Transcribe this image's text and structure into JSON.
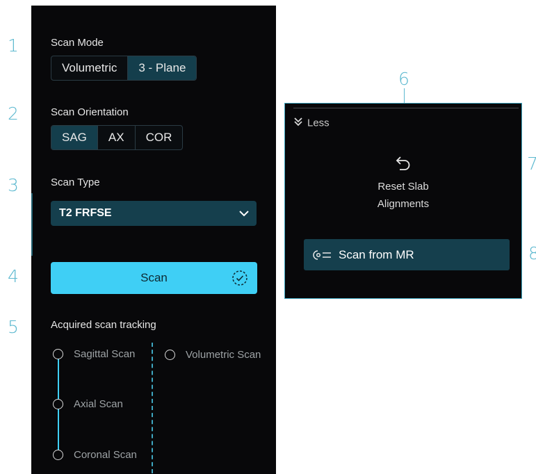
{
  "callouts": [
    "1",
    "2",
    "3",
    "4",
    "5",
    "6",
    "7",
    "8"
  ],
  "scan_mode": {
    "label": "Scan Mode",
    "options": [
      "Volumetric",
      "3 - Plane"
    ],
    "selected": "3 - Plane"
  },
  "scan_orientation": {
    "label": "Scan Orientation",
    "options": [
      "SAG",
      "AX",
      "COR"
    ],
    "selected": "SAG"
  },
  "scan_type": {
    "label": "Scan Type",
    "value": "T2 FRFSE"
  },
  "scan_button": {
    "label": "Scan"
  },
  "tracking": {
    "label": "Acquired scan tracking",
    "items": [
      "Sagittal Scan",
      "Axial Scan",
      "Coronal Scan",
      "Volumetric Scan"
    ]
  },
  "right_panel": {
    "less_label": "Less",
    "reset_label_line1": "Reset Slab",
    "reset_label_line2": "Alignments",
    "scan_from_mr_label": "Scan from MR"
  },
  "colors": {
    "accent": "#3fcff5",
    "selected_fill": "#153f4d",
    "panel_bg": "#08080a",
    "callout": "#5bb8cf"
  },
  "icons": {
    "dropdown": "chevron-down-icon",
    "scan_status": "dashed-circle-check-icon",
    "less": "double-chevron-down-icon",
    "reset": "undo-arrow-icon",
    "scan_from_mr": "scan-from-mr-icon"
  }
}
